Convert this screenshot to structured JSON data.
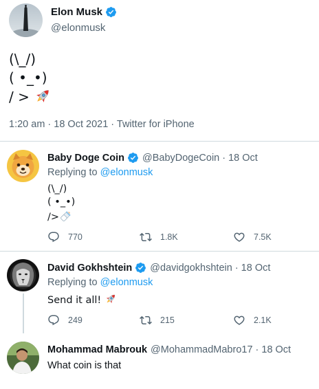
{
  "main_tweet": {
    "author_name": "Elon Musk",
    "author_handle": "@elonmusk",
    "text_line1": "(\\_/)",
    "text_line2": "( •_•)",
    "text_line3": "/ >",
    "text_emoji": "rocket-emoji",
    "meta": "1:20 am · 18 Oct 2021 · Twitter for iPhone"
  },
  "replies": [
    {
      "name": "Baby Doge Coin",
      "handle": "@BabyDogeCoin",
      "date": "18 Oct",
      "verified": true,
      "replying_prefix": "Replying to",
      "replying_mention": "@elonmusk",
      "text_line1": "(\\_/)",
      "text_line2": "( •_•)",
      "text_line3": "/>",
      "text_emoji": "baby-bottle-emoji",
      "reply_count": "",
      "retweets": "1.8K",
      "likes": "7.5K",
      "replies_count": "770"
    },
    {
      "name": "David Gokhshtein",
      "handle": "@davidgokhshtein",
      "date": "18 Oct",
      "verified": true,
      "replying_prefix": "Replying to",
      "replying_mention": "@elonmusk",
      "text": "Send it all!",
      "text_emoji": "rocket-emoji",
      "replies_count": "249",
      "retweets": "215",
      "likes": "2.1K"
    },
    {
      "name": "Mohammad Mabrouk",
      "handle": "@MohammadMabro17",
      "date": "18 Oct",
      "verified": false,
      "text": "What coin is that"
    }
  ],
  "separator": "·",
  "colors": {
    "accent": "#1d9bf0",
    "secondary_text": "#536471",
    "divider": "#cfd9de"
  }
}
